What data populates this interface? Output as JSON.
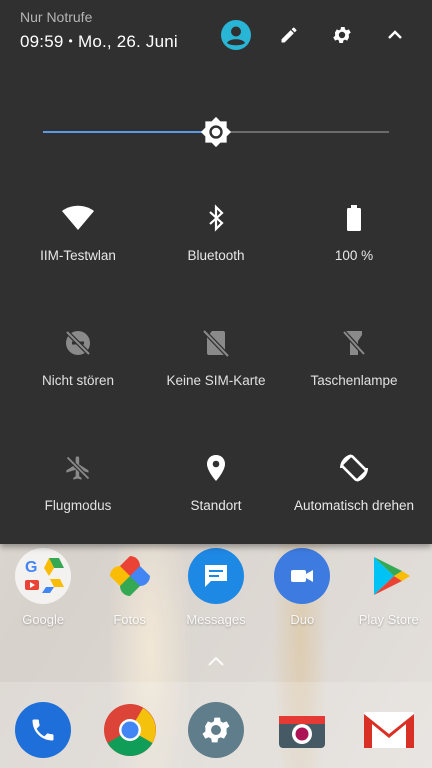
{
  "status": {
    "emergency_text": "Nur Notrufe",
    "time": "09:59",
    "separator": "•",
    "date": "Mo., 26. Juni"
  },
  "header_icons": [
    "user-account-icon",
    "edit-pencil-icon",
    "settings-gear-icon",
    "collapse-chevron-up-icon"
  ],
  "brightness": {
    "level_fraction": 0.5
  },
  "tiles": [
    {
      "label": "IIM-Testwlan",
      "icon": "wifi-icon",
      "active": true
    },
    {
      "label": "Bluetooth",
      "icon": "bluetooth-icon",
      "active": true
    },
    {
      "label": "100 %",
      "icon": "battery-icon",
      "active": true
    },
    {
      "label": "Nicht stören",
      "icon": "do-not-disturb-off-icon",
      "active": false
    },
    {
      "label": "Keine SIM-Karte",
      "icon": "no-sim-icon",
      "active": false
    },
    {
      "label": "Taschenlampe",
      "icon": "flashlight-off-icon",
      "active": false
    },
    {
      "label": "Flugmodus",
      "icon": "airplane-off-icon",
      "active": false
    },
    {
      "label": "Standort",
      "icon": "location-pin-icon",
      "active": true
    },
    {
      "label": "Automatisch drehen",
      "icon": "auto-rotate-icon",
      "active": true
    }
  ],
  "home_apps": [
    {
      "label": "Google",
      "icon": "google-folder-icon"
    },
    {
      "label": "Fotos",
      "icon": "photos-icon"
    },
    {
      "label": "Messages",
      "icon": "messages-icon"
    },
    {
      "label": "Duo",
      "icon": "duo-icon"
    },
    {
      "label": "Play Store",
      "icon": "play-store-icon"
    }
  ],
  "dock_apps": [
    {
      "icon": "phone-icon"
    },
    {
      "icon": "chrome-icon"
    },
    {
      "icon": "settings-app-icon"
    },
    {
      "icon": "camera-icon"
    },
    {
      "icon": "gmail-icon"
    }
  ],
  "colors": {
    "panel": "#303030",
    "accent": "#5c9ae9",
    "avatar": "#29b6d6",
    "active_icon": "#ffffff",
    "inactive_icon": "#8a8a8a"
  }
}
